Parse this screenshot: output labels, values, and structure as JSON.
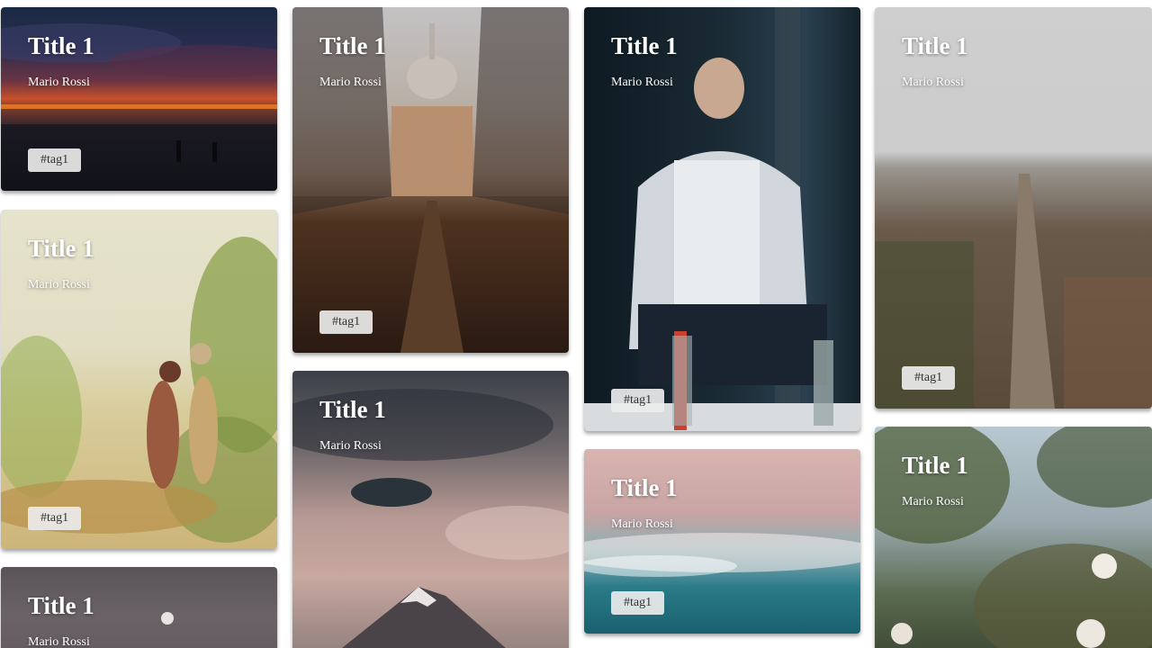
{
  "cards": [
    {
      "id": "sunset-beach",
      "title": "Title 1",
      "author": "Mario Rossi",
      "tag": "#tag1",
      "image": "sunset-beach-photo"
    },
    {
      "id": "cathedral",
      "title": "Title 1",
      "author": "Mario Rossi",
      "tag": "#tag1",
      "image": "cathedral-reflection-photo"
    },
    {
      "id": "hookah-man",
      "title": "Title 1",
      "author": "Mario Rossi",
      "tag": "#tag1",
      "image": "man-with-hookah-photo"
    },
    {
      "id": "city-aerial",
      "title": "Title 1",
      "author": "Mario Rossi",
      "tag": "#tag1",
      "image": "city-aerial-photo"
    },
    {
      "id": "vintage-children",
      "title": "Title 1",
      "author": "Mario Rossi",
      "tag": "#tag1",
      "image": "vintage-illustration-children"
    },
    {
      "id": "mountain-clouds",
      "title": "Title 1",
      "author": "Mario Rossi",
      "tag": "",
      "image": "mountain-clouds-photo"
    },
    {
      "id": "ocean-waves",
      "title": "Title 1",
      "author": "Mario Rossi",
      "tag": "#tag1",
      "image": "ocean-waves-photo"
    },
    {
      "id": "moon-dusk",
      "title": "Title 1",
      "author": "Mario Rossi",
      "tag": "",
      "image": "moon-dusk-photo"
    },
    {
      "id": "flower-branches",
      "title": "Title 1",
      "author": "Mario Rossi",
      "tag": "",
      "image": "flower-branches-photo"
    }
  ]
}
